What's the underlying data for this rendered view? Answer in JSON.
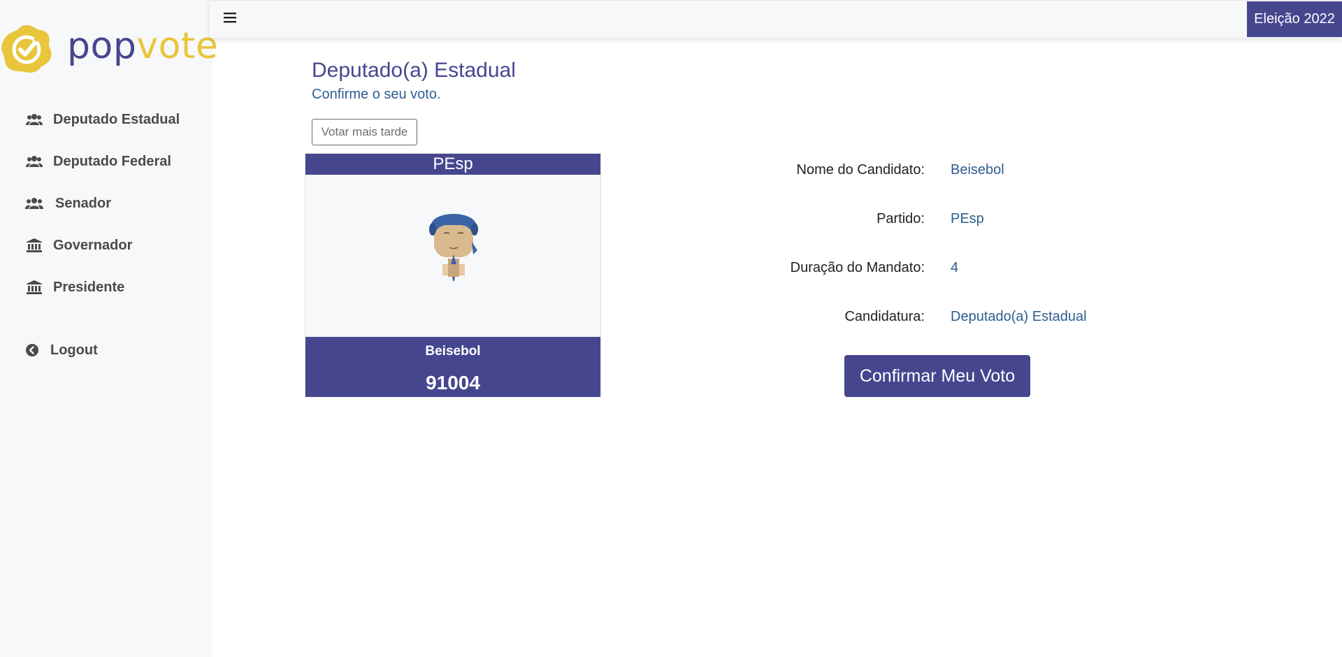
{
  "app": {
    "logo_pop": "pop",
    "logo_vote": "vote",
    "brand_color": "#46468f",
    "accent_color": "#e8c53b"
  },
  "topbar": {
    "menu_icon": "hamburger-icon",
    "election_label": "Eleição 2022"
  },
  "sidebar": {
    "items": [
      {
        "label": "Deputado Estadual",
        "icon": "users-icon"
      },
      {
        "label": "Deputado Federal",
        "icon": "users-icon"
      },
      {
        "label": "Senador",
        "icon": "users-icon"
      },
      {
        "label": "Governador",
        "icon": "bank-icon"
      },
      {
        "label": "Presidente",
        "icon": "bank-icon"
      }
    ],
    "logout": {
      "label": "Logout",
      "icon": "chevron-circle-left-icon"
    }
  },
  "main": {
    "title": "Deputado(a) Estadual",
    "subtitle": "Confirme o seu voto.",
    "later_button": "Votar mais tarde",
    "card": {
      "party": "PEsp",
      "name": "Beisebol",
      "number": "91004"
    },
    "details": [
      {
        "label": "Nome do Candidato:",
        "value": "Beisebol"
      },
      {
        "label": "Partido:",
        "value": "PEsp"
      },
      {
        "label": "Duração do Mandato:",
        "value": "4"
      },
      {
        "label": "Candidatura:",
        "value": "Deputado(a) Estadual"
      }
    ],
    "confirm_button": "Confirmar Meu Voto"
  }
}
